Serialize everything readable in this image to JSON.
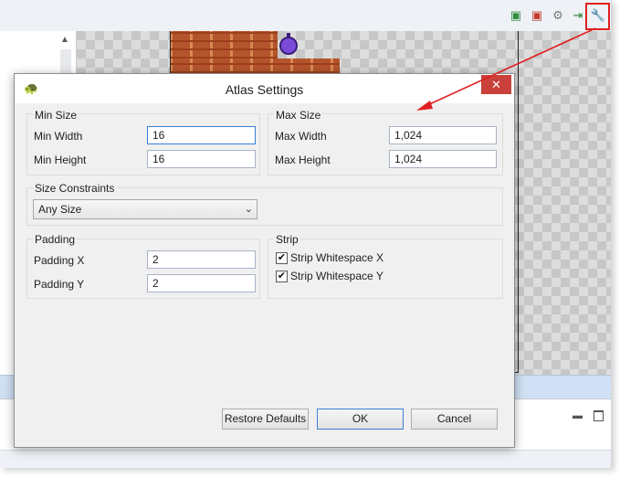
{
  "toolbar": {
    "icons": [
      "add-image-icon",
      "remove-image-icon",
      "settings-gear-icon",
      "export-icon",
      "wrench-icon"
    ]
  },
  "dialog": {
    "title": "Atlas Settings",
    "close_glyph": "✕",
    "min_size": {
      "group_label": "Min Size",
      "width_label": "Min Width",
      "width_value": "16",
      "height_label": "Min Height",
      "height_value": "16"
    },
    "max_size": {
      "group_label": "Max Size",
      "width_label": "Max Width",
      "width_value": "1,024",
      "height_label": "Max Height",
      "height_value": "1,024"
    },
    "size_constraints": {
      "group_label": "Size Constraints",
      "selected": "Any Size"
    },
    "padding": {
      "group_label": "Padding",
      "x_label": "Padding X",
      "x_value": "2",
      "y_label": "Padding Y",
      "y_value": "2"
    },
    "strip": {
      "group_label": "Strip",
      "x_label": "Strip Whitespace X",
      "x_checked": true,
      "y_label": "Strip Whitespace Y",
      "y_checked": true
    },
    "buttons": {
      "restore": "Restore Defaults",
      "ok": "OK",
      "cancel": "Cancel"
    }
  },
  "colors": {
    "annotation_red": "#e02020",
    "close_button": "#c9413a",
    "focus_blue": "#3b7ed4"
  }
}
